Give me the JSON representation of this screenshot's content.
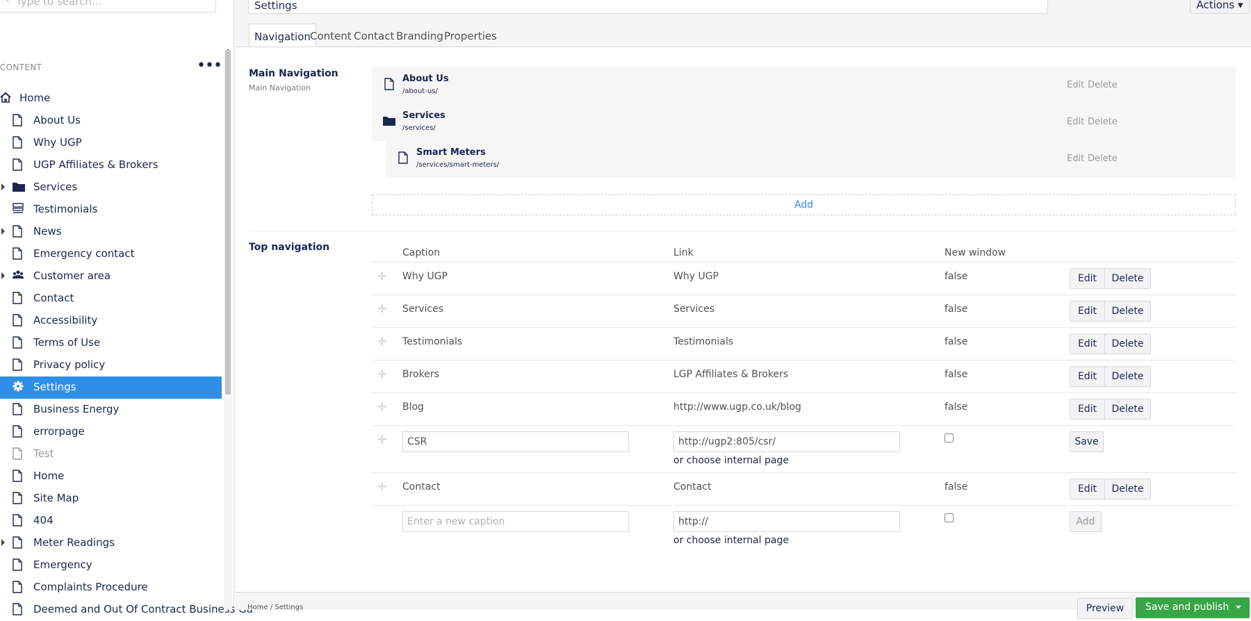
{
  "sidebar": {
    "search_placeholder": "Type to search...",
    "section_title": "CONTENT",
    "more": "•••",
    "items": [
      {
        "label": "Home",
        "icon": "home-icon"
      },
      {
        "label": "About Us",
        "icon": "document-icon"
      },
      {
        "label": "Why UGP",
        "icon": "document-icon"
      },
      {
        "label": "UGP Affiliates & Brokers",
        "icon": "document-icon"
      },
      {
        "label": "Services",
        "icon": "folder-icon",
        "expandable": true
      },
      {
        "label": "Testimonials",
        "icon": "list-icon"
      },
      {
        "label": "News",
        "icon": "document-icon",
        "expandable": true
      },
      {
        "label": "Emergency contact",
        "icon": "document-icon"
      },
      {
        "label": "Customer area",
        "icon": "users-icon",
        "expandable": true
      },
      {
        "label": "Contact",
        "icon": "document-icon"
      },
      {
        "label": "Accessibility",
        "icon": "document-icon"
      },
      {
        "label": "Terms of Use",
        "icon": "document-icon"
      },
      {
        "label": "Privacy policy",
        "icon": "document-icon"
      },
      {
        "label": "Settings",
        "icon": "gear-icon",
        "selected": true
      },
      {
        "label": "Business Energy",
        "icon": "document-icon"
      },
      {
        "label": "errorpage",
        "icon": "document-icon"
      },
      {
        "label": "Test",
        "icon": "document-icon",
        "dimmed": true
      },
      {
        "label": "Home",
        "icon": "document-icon"
      },
      {
        "label": "Site Map",
        "icon": "document-icon"
      },
      {
        "label": "404",
        "icon": "document-icon"
      },
      {
        "label": "Meter Readings",
        "icon": "document-icon",
        "expandable": true
      },
      {
        "label": "Emergency",
        "icon": "document-icon"
      },
      {
        "label": "Complaints Procedure",
        "icon": "document-icon"
      },
      {
        "label": "Deemed and Out Of Contract Business Ga",
        "icon": "document-icon"
      }
    ]
  },
  "header": {
    "title_value": "Settings",
    "actions_label": "Actions ▾"
  },
  "tabs": [
    "Navigation",
    "Content",
    "Contact",
    "Branding",
    "Properties"
  ],
  "main_navigation": {
    "label": "Main Navigation",
    "description": "Main Navigation",
    "items": [
      {
        "name": "About Us",
        "url": "/about-us/",
        "icon": "document-icon"
      },
      {
        "name": "Services",
        "url": "/services/",
        "icon": "folder-icon"
      },
      {
        "name": "Smart Meters",
        "url": "/services/smart-meters/",
        "icon": "document-icon"
      }
    ],
    "edit_label": "Edit",
    "delete_label": "Delete",
    "add_label": "Add"
  },
  "top_navigation": {
    "label": "Top navigation",
    "headers": {
      "caption": "Caption",
      "link": "Link",
      "new_window": "New window"
    },
    "rows": [
      {
        "caption": "Why UGP",
        "link": "Why UGP",
        "new_window": "false"
      },
      {
        "caption": "Services",
        "link": "Services",
        "new_window": "false"
      },
      {
        "caption": "Testimonials",
        "link": "Testimonials",
        "new_window": "false"
      },
      {
        "caption": "Brokers",
        "link": "LGP Affiliates & Brokers",
        "new_window": "false"
      },
      {
        "caption": "Blog",
        "link": "http://www.ugp.co.uk/blog",
        "new_window": "false"
      }
    ],
    "editing_row": {
      "caption_value": "CSR",
      "link_value": "http://ugp2:805/csr/",
      "choose_internal": "or choose internal page",
      "save_label": "Save"
    },
    "row_after": {
      "caption": "Contact",
      "link": "Contact",
      "new_window": "false"
    },
    "new_row": {
      "caption_placeholder": "Enter a new caption",
      "link_value": "http://",
      "choose_internal": "or choose internal page",
      "add_label": "Add"
    },
    "edit_label": "Edit",
    "delete_label": "Delete"
  },
  "footer": {
    "breadcrumb": "Home  /  Settings",
    "preview_label": "Preview",
    "save_publish_label": "Save and publish"
  },
  "colors": {
    "accent": "#2e8fe8",
    "publish": "#38a646",
    "text": "#1b264f"
  }
}
